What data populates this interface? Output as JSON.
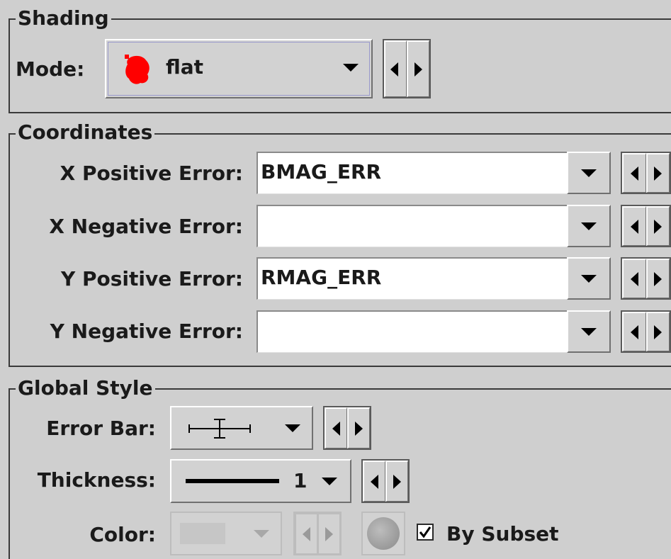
{
  "shading": {
    "legend": "Shading",
    "mode_label": "Mode:",
    "mode_value": "flat",
    "mode_icon_color": "#ff0000"
  },
  "coordinates": {
    "legend": "Coordinates",
    "rows": [
      {
        "label": "X Positive Error:",
        "value": "BMAG_ERR"
      },
      {
        "label": "X Negative Error:",
        "value": ""
      },
      {
        "label": "Y Positive Error:",
        "value": "RMAG_ERR"
      },
      {
        "label": "Y Negative Error:",
        "value": ""
      }
    ]
  },
  "global_style": {
    "legend": "Global Style",
    "error_bar_label": "Error Bar:",
    "thickness_label": "Thickness:",
    "thickness_value": "1",
    "color_label": "Color:",
    "by_subset_label": "By Subset",
    "by_subset_checked": true
  }
}
